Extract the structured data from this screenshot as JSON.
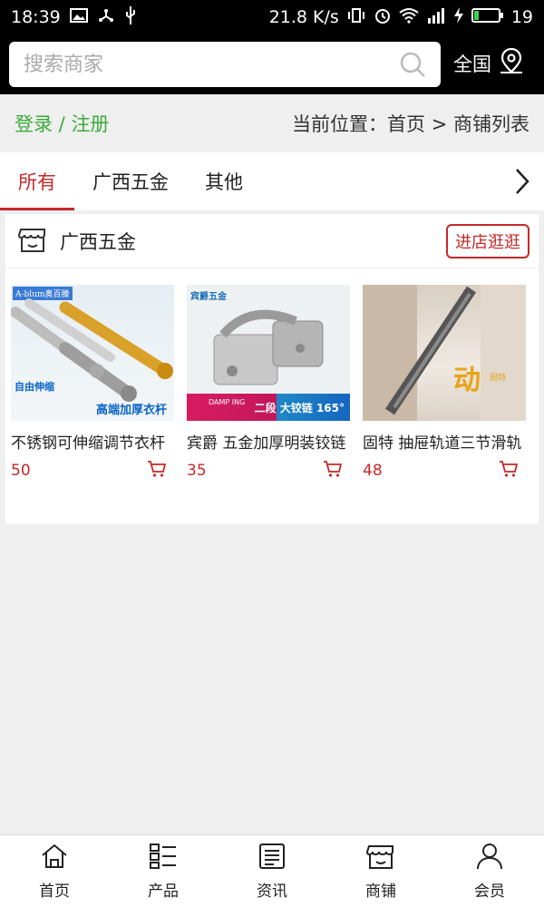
{
  "status_bar": {
    "time": "18:39",
    "net_speed": "21.8 K/s",
    "battery": "19"
  },
  "search": {
    "placeholder": "搜索商家",
    "region_label": "全国"
  },
  "breadcrumb": {
    "login": "登录",
    "separator": " / ",
    "register": "注册",
    "location": "当前位置：首页 > 商铺列表"
  },
  "tabs": [
    {
      "label": "所有",
      "active": true
    },
    {
      "label": "广西五金",
      "active": false
    },
    {
      "label": "其他",
      "active": false
    }
  ],
  "store": {
    "name": "广西五金",
    "visit_label": "进店逛逛",
    "products": [
      {
        "title": "不锈钢可伸缩调节衣杆",
        "price": "50",
        "img_logo": "A-blum奥百滕",
        "img_caption_1": "自由伸缩",
        "img_caption_2": "高端加厚衣杆"
      },
      {
        "title": "宾爵 五金加厚明装铰链",
        "price": "35",
        "img_logo": "宾爵五金",
        "img_caption_1": "DAMP ING",
        "img_caption_2": "二段 大铰链 165°"
      },
      {
        "title": "固特 抽屉轨道三节滑轨",
        "price": "48",
        "img_logo": "",
        "img_caption_1": "动",
        "img_caption_2": "固特"
      }
    ]
  },
  "bottom_nav": [
    {
      "label": "首页",
      "icon": "home-icon"
    },
    {
      "label": "产品",
      "icon": "list-icon"
    },
    {
      "label": "资讯",
      "icon": "news-icon"
    },
    {
      "label": "商铺",
      "icon": "store-icon"
    },
    {
      "label": "会员",
      "icon": "user-icon"
    }
  ],
  "colors": {
    "accent": "#c62828",
    "login_green": "#3bab3b",
    "header_bg": "#000000"
  }
}
